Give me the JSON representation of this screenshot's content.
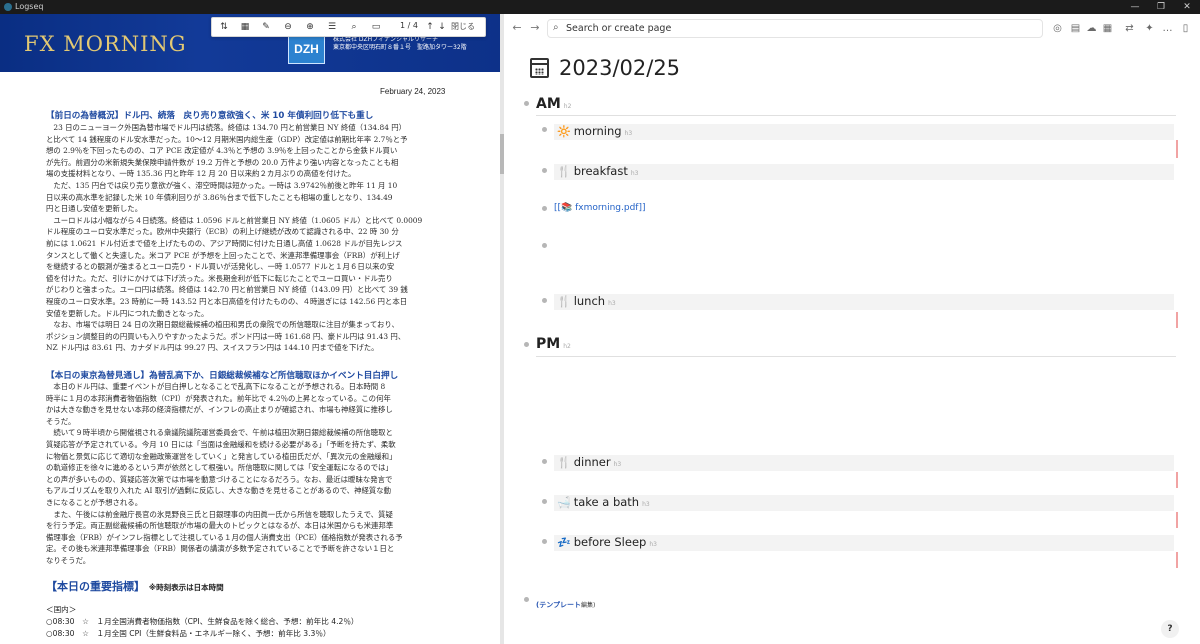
{
  "window": {
    "title": "Logseq",
    "buttons": [
      "—",
      "❐",
      "✕"
    ]
  },
  "pdf": {
    "toolbar": {
      "page_indicator": "1 / 4",
      "up": "↑",
      "down": "↓",
      "close_label": "閉じる"
    },
    "logo": "FX MORNING",
    "dzh": "DZH",
    "company_lines": [
      "株式会社 DZHフィナンシャルリサーチ",
      "東京都中央区明石町８番１号　聖路加タワー32階"
    ],
    "date": "February 24, 2023",
    "section1_heading": "【前日の為替概況】ドル円、続落　戻り売り意欲強く、米 10 年債利回り低下も重し",
    "section1_lines": [
      "　23 日のニューヨーク外国為替市場でドル円は続落。終値は 134.70 円と前営業日 NY 終値（134.84 円）",
      "と比べて 14 銭程度のドル安水準だった。10～12 月期米国内総生産（GDP）改定値は前期比年率 2.7％と予",
      "想の 2.9％を下回ったものの、コア PCE 改定値が 4.3％と予想の 3.9％を上回ったことから金鉄ドル買い",
      "が先行。前週分の米新規失業保険申請件数が 19.2 万件と予想の 20.0 万件より強い内容となったことも相",
      "場の支援材料となり、一時 135.36 円と昨年 12 月 20 日以来約２カ月ぶりの高値を付けた。",
      "　ただ、135 円台では戻り売り意欲が強く、滞空時間は短かった。一時は 3.9742％前後と昨年 11 月 10",
      "日以来の高水準を記録した米 10 年債利回りが 3.86％台まで低下したことも相場の重しとなり、134.49",
      "円と日通し安値を更新した。",
      "　ユーロドルは小幅ながら４日続落。終値は 1.0596 ドルと前営業日 NY 終値（1.0605 ドル）と比べて 0.0009",
      "ドル程度のユーロ安水準だった。欧州中央銀行（ECB）の利上げ継続が改めて認識される中、22 時 30 分",
      "前には 1.0621 ドル付近まで値を上げたものの、アジア時間に付けた日通し高値 1.0628 ドルが目先レジス",
      "タンスとして働くと失速した。米コア PCE が予想を上回ったことで、米連邦準備理事会（FRB）が利上げ",
      "を継続するとの観測が強まるとユーロ売り・ドル買いが活発化し、一時 1.0577 ドルと１月６日以来の安",
      "値を付けた。ただ、引けにかけては下げ渋った。米長期金利が低下に転じたことでユーロ買い・ドル売り",
      "がじわりと強まった。ユーロ円は続落。終値は 142.70 円と前営業日 NY 終値（143.09 円）と比べて 39 銭",
      "程度のユーロ安水準。23 時前に一時 143.52 円と本日高値を付けたものの、４時過ぎには 142.56 円と本日",
      "安値を更新した。ドル円につれた動きとなった。",
      "　なお、市場では明日 24 日の次期日銀総裁候補の植田和男氏の衆院での所信聴取に注目が集まっており、",
      "ポジション調整目的の円買いも入りやすかったようだ。ポンド円は一時 161.68 円、豪ドル円は 91.43 円、",
      "NZ ドル円は 83.61 円、カナダドル円は 99.27 円、スイスフラン円は 144.10 円まで値を下げた。"
    ],
    "section2_heading": "【本日の東京為替見通し】為替乱高下か、日銀総裁候補など所信聴取ほかイベント目白押し",
    "section2_lines": [
      "　本日のドル円は、重要イベントが目白押しとなることで乱高下になることが予想される。日本時間 8",
      "時半に１月の本邦消費者物価指数（CPI）が発表された。前年比で 4.2％の上昇となっている。この何年",
      "かは大きな動きを見せない本邦の経済指標だが、インフレの高止まりが確認され、市場も神経質に推移し",
      "そうだ。",
      "　続いて９時半頃から開催視される衆議院議院運営委員会で、午前は植田次期日銀総裁候補の所信聴取と",
      "質疑応答が予定されている。今月 10 日には「当面は金融緩和を続ける必要がある」「予断を持たず、柔軟",
      "に物価と景気に応じて適切な金融政策運営をしていく」と発言している植田氏だが、「異次元の金融緩和」",
      "の軌道修正を徐々に進めるという声が依然として根強い。所信聴取に関しては「安全運転になるのでは」",
      "との声が多いものの、質疑応答次第では市場を動意づけることになるだろう。なお、最近は曖昧な発言で",
      "もアルゴリズムを取り入れた AI 取引が過剰に反応し、大きな動きを見せることがあるので、神経質な動",
      "きになることが予想される。",
      "　また、午後には前金融庁長官の氷見野良三氏と日銀理事の内田眞一氏から所信を聴取したうえで、質疑",
      "を行う予定。両正副総裁候補の所信聴取が市場の最大のトピックとはなるが、本日は米国からも米連邦準",
      "備理事会（FRB）がインフレ指標として注視している１月の個人消費支出（PCE）価格指数が発表される予",
      "定。その後も米連邦準備理事会（FRB）関係者の講演が多数予定されていることで予断を許さない１日と",
      "なりそうだ。"
    ],
    "section3_heading": "【本日の重要指標】",
    "section3_note": "※時刻表示は日本時間",
    "list_header": "＜国内＞",
    "list_items": [
      "○08:30　☆　１月全国消費者物価指数（CPI、生鮮食品を除く総合、予想：前年比 4.2％）",
      "○08:30　☆　１月全国 CPI（生鮮食料品・エネルギー除く、予想：前年比 3.3％）"
    ]
  },
  "logseq": {
    "search_placeholder": "Search or create page",
    "journal_title": "2023/02/25",
    "am_label": "AM",
    "pm_label": "PM",
    "h2_hint": "h2",
    "h3_hint": "h3",
    "blocks": {
      "morning": {
        "emoji": "🔆",
        "label": "morning"
      },
      "breakfast": {
        "emoji": "🍴",
        "label": "breakfast"
      },
      "lunch": {
        "emoji": "🍴",
        "label": "lunch"
      },
      "dinner": {
        "emoji": "🍴",
        "label": "dinner"
      },
      "bath": {
        "emoji": "🛁",
        "label": "take a bath"
      },
      "sleep": {
        "emoji": "💤",
        "label": "before Sleep"
      }
    },
    "pdf_link": "[[📚 fxmorning.pdf]]",
    "template_link": "(テンプレート",
    "template_link_suffix": "編集)",
    "help": "?"
  }
}
